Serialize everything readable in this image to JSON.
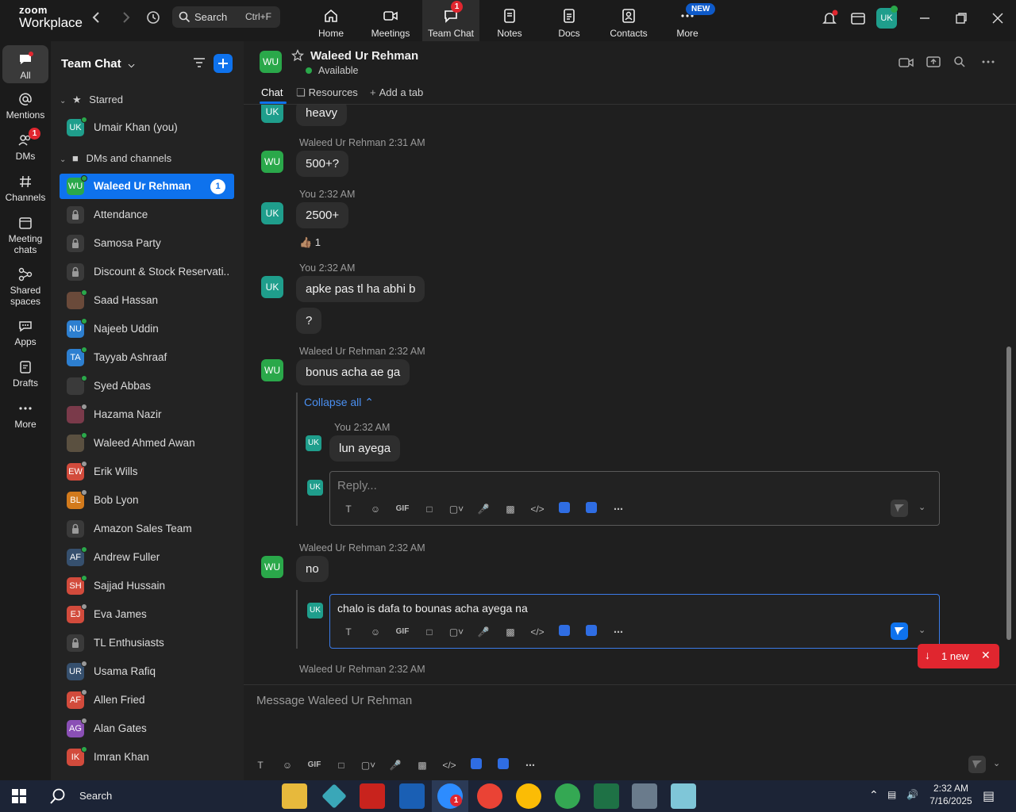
{
  "app": {
    "brand_top": "zoom",
    "brand_bottom": "Workplace"
  },
  "search": {
    "label": "Search",
    "shortcut": "Ctrl+F"
  },
  "topnav": [
    {
      "label": "Home",
      "icon": "home-icon"
    },
    {
      "label": "Meetings",
      "icon": "video-icon"
    },
    {
      "label": "Team Chat",
      "icon": "chat-icon",
      "badge": "1"
    },
    {
      "label": "Notes",
      "icon": "notes-icon"
    },
    {
      "label": "Docs",
      "icon": "docs-icon"
    },
    {
      "label": "Contacts",
      "icon": "contacts-icon"
    },
    {
      "label": "More",
      "icon": "more-icon",
      "pill": "NEW"
    }
  ],
  "user_avatar": "UK",
  "rail": [
    {
      "label": "All",
      "icon": "chat-bubble-icon"
    },
    {
      "label": "Mentions",
      "icon": "at-icon"
    },
    {
      "label": "DMs",
      "icon": "people-icon",
      "badge": "1"
    },
    {
      "label": "Channels",
      "icon": "hash-icon"
    },
    {
      "label": "Meeting chats",
      "line1": "Meeting",
      "line2": "chats",
      "icon": "calendar-icon"
    },
    {
      "label": "Shared spaces",
      "line1": "Shared",
      "line2": "spaces",
      "icon": "share-icon"
    },
    {
      "label": "Apps",
      "icon": "apps-icon"
    },
    {
      "label": "Drafts",
      "icon": "drafts-icon"
    },
    {
      "label": "More",
      "icon": "more-dots-icon"
    }
  ],
  "sidebar": {
    "title": "Team Chat",
    "starred_label": "Starred",
    "dms_label": "DMs and channels",
    "starred": [
      {
        "initials": "UK",
        "name": "Umair Khan (you)",
        "color": "#1f9e8c",
        "presence": "#2aa84a"
      }
    ],
    "items": [
      {
        "initials": "WU",
        "name": "Waleed Ur Rehman",
        "color": "#2aa84a",
        "presence": "#2aa84a",
        "count": "1",
        "active": true
      },
      {
        "initials": "",
        "name": "Attendance",
        "lock": true
      },
      {
        "initials": "",
        "name": "Samosa Party",
        "lock": true
      },
      {
        "initials": "",
        "name": "Discount & Stock Reservati...",
        "lock": true
      },
      {
        "initials": "",
        "name": "Saad Hassan",
        "photo": "#6a4a3a",
        "presence": "#2aa84a"
      },
      {
        "initials": "NU",
        "name": "Najeeb Uddin",
        "color": "#2d7fd0",
        "presence": "#2aa84a"
      },
      {
        "initials": "TA",
        "name": "Tayyab Ashraaf",
        "color": "#2d7fd0",
        "presence": "#2aa84a"
      },
      {
        "initials": "",
        "name": "Syed Abbas",
        "photo": "#3a3a3a",
        "presence": "#2aa84a"
      },
      {
        "initials": "",
        "name": "Hazama Nazir",
        "photo": "#7a3a4a",
        "presence": "#999999"
      },
      {
        "initials": "",
        "name": "Waleed Ahmed Awan",
        "photo": "#5a5040",
        "presence": "#2aa84a"
      },
      {
        "initials": "EW",
        "name": "Erik Wills",
        "color": "#d24b3c",
        "presence": "#999999"
      },
      {
        "initials": "BL",
        "name": "Bob Lyon",
        "color": "#d27a1c",
        "presence": "#999999"
      },
      {
        "initials": "",
        "name": "Amazon Sales Team",
        "lock": true
      },
      {
        "initials": "AF",
        "name": "Andrew Fuller",
        "color": "#36506e",
        "presence": "#2aa84a"
      },
      {
        "initials": "SH",
        "name": "Sajjad Hussain",
        "color": "#d24b3c",
        "presence": "#2aa84a"
      },
      {
        "initials": "EJ",
        "name": "Eva James",
        "color": "#d24b3c",
        "presence": "#999999"
      },
      {
        "initials": "",
        "name": "TL Enthusiasts",
        "lock": true
      },
      {
        "initials": "UR",
        "name": "Usama Rafiq",
        "color": "#36506e",
        "presence": "#999999"
      },
      {
        "initials": "AF",
        "name": "Allen Fried",
        "color": "#d24b3c",
        "presence": "#999999"
      },
      {
        "initials": "AG",
        "name": "Alan Gates",
        "color": "#8a4fb5",
        "presence": "#999999"
      },
      {
        "initials": "IK",
        "name": "Imran Khan",
        "color": "#d24b3c",
        "presence": "#2aa84a"
      }
    ]
  },
  "chat": {
    "contact_initials": "WU",
    "contact_name": "Waleed Ur Rehman",
    "status": "Available",
    "tabs": {
      "chat": "Chat",
      "resources": "Resources",
      "add": "Add a tab"
    }
  },
  "messages": {
    "m0_text": "heavy",
    "m1_meta": "Waleed Ur Rehman 2:31 AM",
    "m1_text": "500+?",
    "m2_meta": "You 2:32 AM",
    "m2_text": "2500+",
    "m2_reaction": "👍🏽 1",
    "m3_meta": "You 2:32 AM",
    "m3_text1": "apke pas tl ha abhi b",
    "m3_text2": "?",
    "m4_meta": "Waleed Ur Rehman 2:32 AM",
    "m4_text": "bonus acha ae ga",
    "collapse": "Collapse all",
    "thread_meta": "You 2:32 AM",
    "thread_text": "lun ayega",
    "reply_placeholder": "Reply...",
    "m5_meta": "Waleed Ur Rehman 2:32 AM",
    "m5_text": "no",
    "draft_text": "chalo is dafa to bounas acha ayega na",
    "m6_meta": "Waleed Ur Rehman 2:32 AM",
    "new_label": "1 new"
  },
  "composer": {
    "placeholder": "Message Waleed Ur Rehman"
  },
  "taskbar": {
    "search": "Search",
    "time": "2:32 AM",
    "date": "7/16/2025",
    "zoom_badge": "1"
  },
  "colors": {
    "accent": "#0e72ed",
    "alert": "#e0262f",
    "available": "#2aa84a"
  }
}
